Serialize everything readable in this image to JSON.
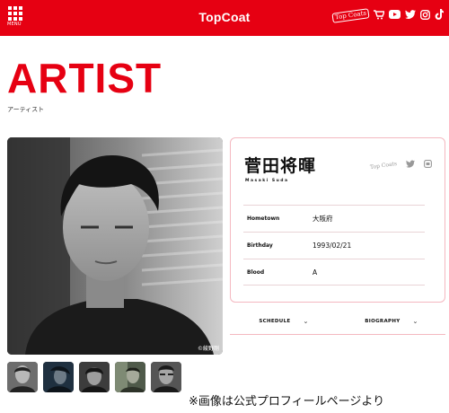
{
  "header": {
    "menu_label": "MENU",
    "brand": "TopCoat",
    "fanclub_logo_text": "Top Coats",
    "icons": [
      "fanclub-icon",
      "cart-icon",
      "youtube-icon",
      "twitter-icon",
      "instagram-icon",
      "tiktok-icon"
    ],
    "color": "#e60012"
  },
  "page": {
    "title": "ARTIST",
    "subtitle": "アーティスト"
  },
  "photo": {
    "credit": "©綾野剛"
  },
  "profile": {
    "name_jp": "菅田将暉",
    "name_en": "Masaki Suda",
    "fanclub_logo_text": "Top Coats",
    "rows": [
      {
        "key": "Hometown",
        "value": "大阪府"
      },
      {
        "key": "Birthday",
        "value": "1993/02/21"
      },
      {
        "key": "Blood",
        "value": "A"
      }
    ]
  },
  "tabs": [
    {
      "label": "SCHEDULE"
    },
    {
      "label": "BIOGRAPHY"
    }
  ],
  "caption": "※画像は公式プロフィールページより"
}
